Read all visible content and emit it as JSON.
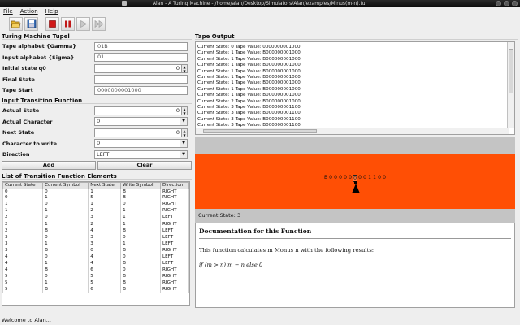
{
  "window": {
    "title": "Alan - A Turing Machine - /home/alan/Desktop/Simulators/Alan/examples/Minus(m-n).tur"
  },
  "menu": {
    "file": "File",
    "action": "Action",
    "help": "Help"
  },
  "toolbar": {
    "icons": [
      "open-icon",
      "save-icon",
      "stop-icon",
      "pause-icon",
      "play-icon",
      "step-forward-icon"
    ]
  },
  "tuple": {
    "section": "Turing Machine Tupel",
    "tape_alphabet_label": "Tape alphabet {Gamma}",
    "tape_alphabet_value": "01B",
    "input_alphabet_label": "Input alphabet {Sigma}",
    "input_alphabet_value": "01",
    "initial_state_label": "Initial state q0",
    "initial_state_value": "0",
    "final_state_label": "Final State",
    "final_state_value": "",
    "tape_start_label": "Tape Start",
    "tape_start_value": "0000000001000"
  },
  "input_fn": {
    "section": "Input Transition Function",
    "actual_state_label": "Actual State",
    "actual_state_value": "0",
    "actual_char_label": "Actual Character",
    "actual_char_value": "0",
    "next_state_label": "Next State",
    "next_state_value": "0",
    "char_write_label": "Character to write",
    "char_write_value": "0",
    "direction_label": "Direction",
    "direction_value": "LEFT",
    "add_label": "Add",
    "clear_label": "Clear"
  },
  "table": {
    "section": "List of Transition Function Elements",
    "headers": [
      "Current State",
      "Current Symbol",
      "Next State",
      "Write Symbol",
      "Direction"
    ],
    "rows": [
      [
        "0",
        "0",
        "1",
        "B",
        "RIGHT"
      ],
      [
        "0",
        "1",
        "5",
        "B",
        "RIGHT"
      ],
      [
        "1",
        "0",
        "1",
        "0",
        "RIGHT"
      ],
      [
        "1",
        "1",
        "2",
        "1",
        "RIGHT"
      ],
      [
        "2",
        "0",
        "3",
        "1",
        "LEFT"
      ],
      [
        "2",
        "1",
        "2",
        "1",
        "RIGHT"
      ],
      [
        "2",
        "B",
        "4",
        "B",
        "LEFT"
      ],
      [
        "3",
        "0",
        "3",
        "0",
        "LEFT"
      ],
      [
        "3",
        "1",
        "3",
        "1",
        "LEFT"
      ],
      [
        "3",
        "B",
        "0",
        "B",
        "RIGHT"
      ],
      [
        "4",
        "0",
        "4",
        "0",
        "LEFT"
      ],
      [
        "4",
        "1",
        "4",
        "B",
        "LEFT"
      ],
      [
        "4",
        "B",
        "6",
        "0",
        "RIGHT"
      ],
      [
        "5",
        "0",
        "5",
        "B",
        "RIGHT"
      ],
      [
        "5",
        "1",
        "5",
        "B",
        "RIGHT"
      ],
      [
        "5",
        "B",
        "6",
        "B",
        "RIGHT"
      ]
    ]
  },
  "output": {
    "section": "Tape Output",
    "lines": [
      "Current State: 0 Tape Value: 0000000001000",
      "Current State: 1 Tape Value: B000000001000",
      "Current State: 1 Tape Value: B000000001000",
      "Current State: 1 Tape Value: B000000001000",
      "Current State: 1 Tape Value: B000000001000",
      "Current State: 1 Tape Value: B000000001000",
      "Current State: 1 Tape Value: B000000001000",
      "Current State: 1 Tape Value: B000000001000",
      "Current State: 1 Tape Value: B000000001000",
      "Current State: 2 Tape Value: B000000001000",
      "Current State: 3 Tape Value: B000000001100",
      "Current State: 3 Tape Value: B000000001100",
      "Current State: 3 Tape Value: B000000001100",
      "Current State: 3 Tape Value: B000000001100"
    ]
  },
  "sim": {
    "tape_cells": [
      "B",
      "0",
      "0",
      "0",
      "0",
      "0",
      "0",
      "0",
      "0",
      "1",
      "1",
      "0",
      "0"
    ],
    "head_index": 6,
    "current_state": "Current State: 3",
    "bg_color": "#ff4f05"
  },
  "doc": {
    "heading": "Documentation for this Function",
    "text": "This function calculates m Monus n with the following results:",
    "formula": "if (m > n) m − n else 0"
  },
  "status": "Welcome to Alan..."
}
